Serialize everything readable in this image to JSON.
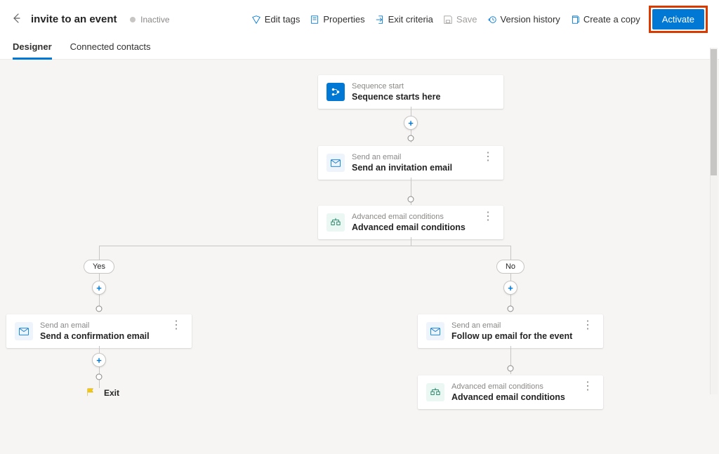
{
  "header": {
    "title": "invite to an event",
    "status": "Inactive",
    "cmds": {
      "edit_tags": "Edit tags",
      "properties": "Properties",
      "exit_criteria": "Exit criteria",
      "save": "Save",
      "version_history": "Version history",
      "create_copy": "Create a copy",
      "activate": "Activate"
    }
  },
  "tabs": {
    "designer": "Designer",
    "connected_contacts": "Connected contacts"
  },
  "nodes": {
    "start": {
      "kind": "Sequence start",
      "title": "Sequence starts here"
    },
    "email1": {
      "kind": "Send an email",
      "title": "Send an invitation email"
    },
    "cond1": {
      "kind": "Advanced email conditions",
      "title": "Advanced email conditions"
    },
    "emailYes": {
      "kind": "Send an email",
      "title": "Send a confirmation email"
    },
    "emailNo": {
      "kind": "Send an email",
      "title": "Follow up email for the event"
    },
    "cond2": {
      "kind": "Advanced email conditions",
      "title": "Advanced email conditions"
    },
    "branch_yes": "Yes",
    "branch_no": "No",
    "exit": "Exit"
  }
}
